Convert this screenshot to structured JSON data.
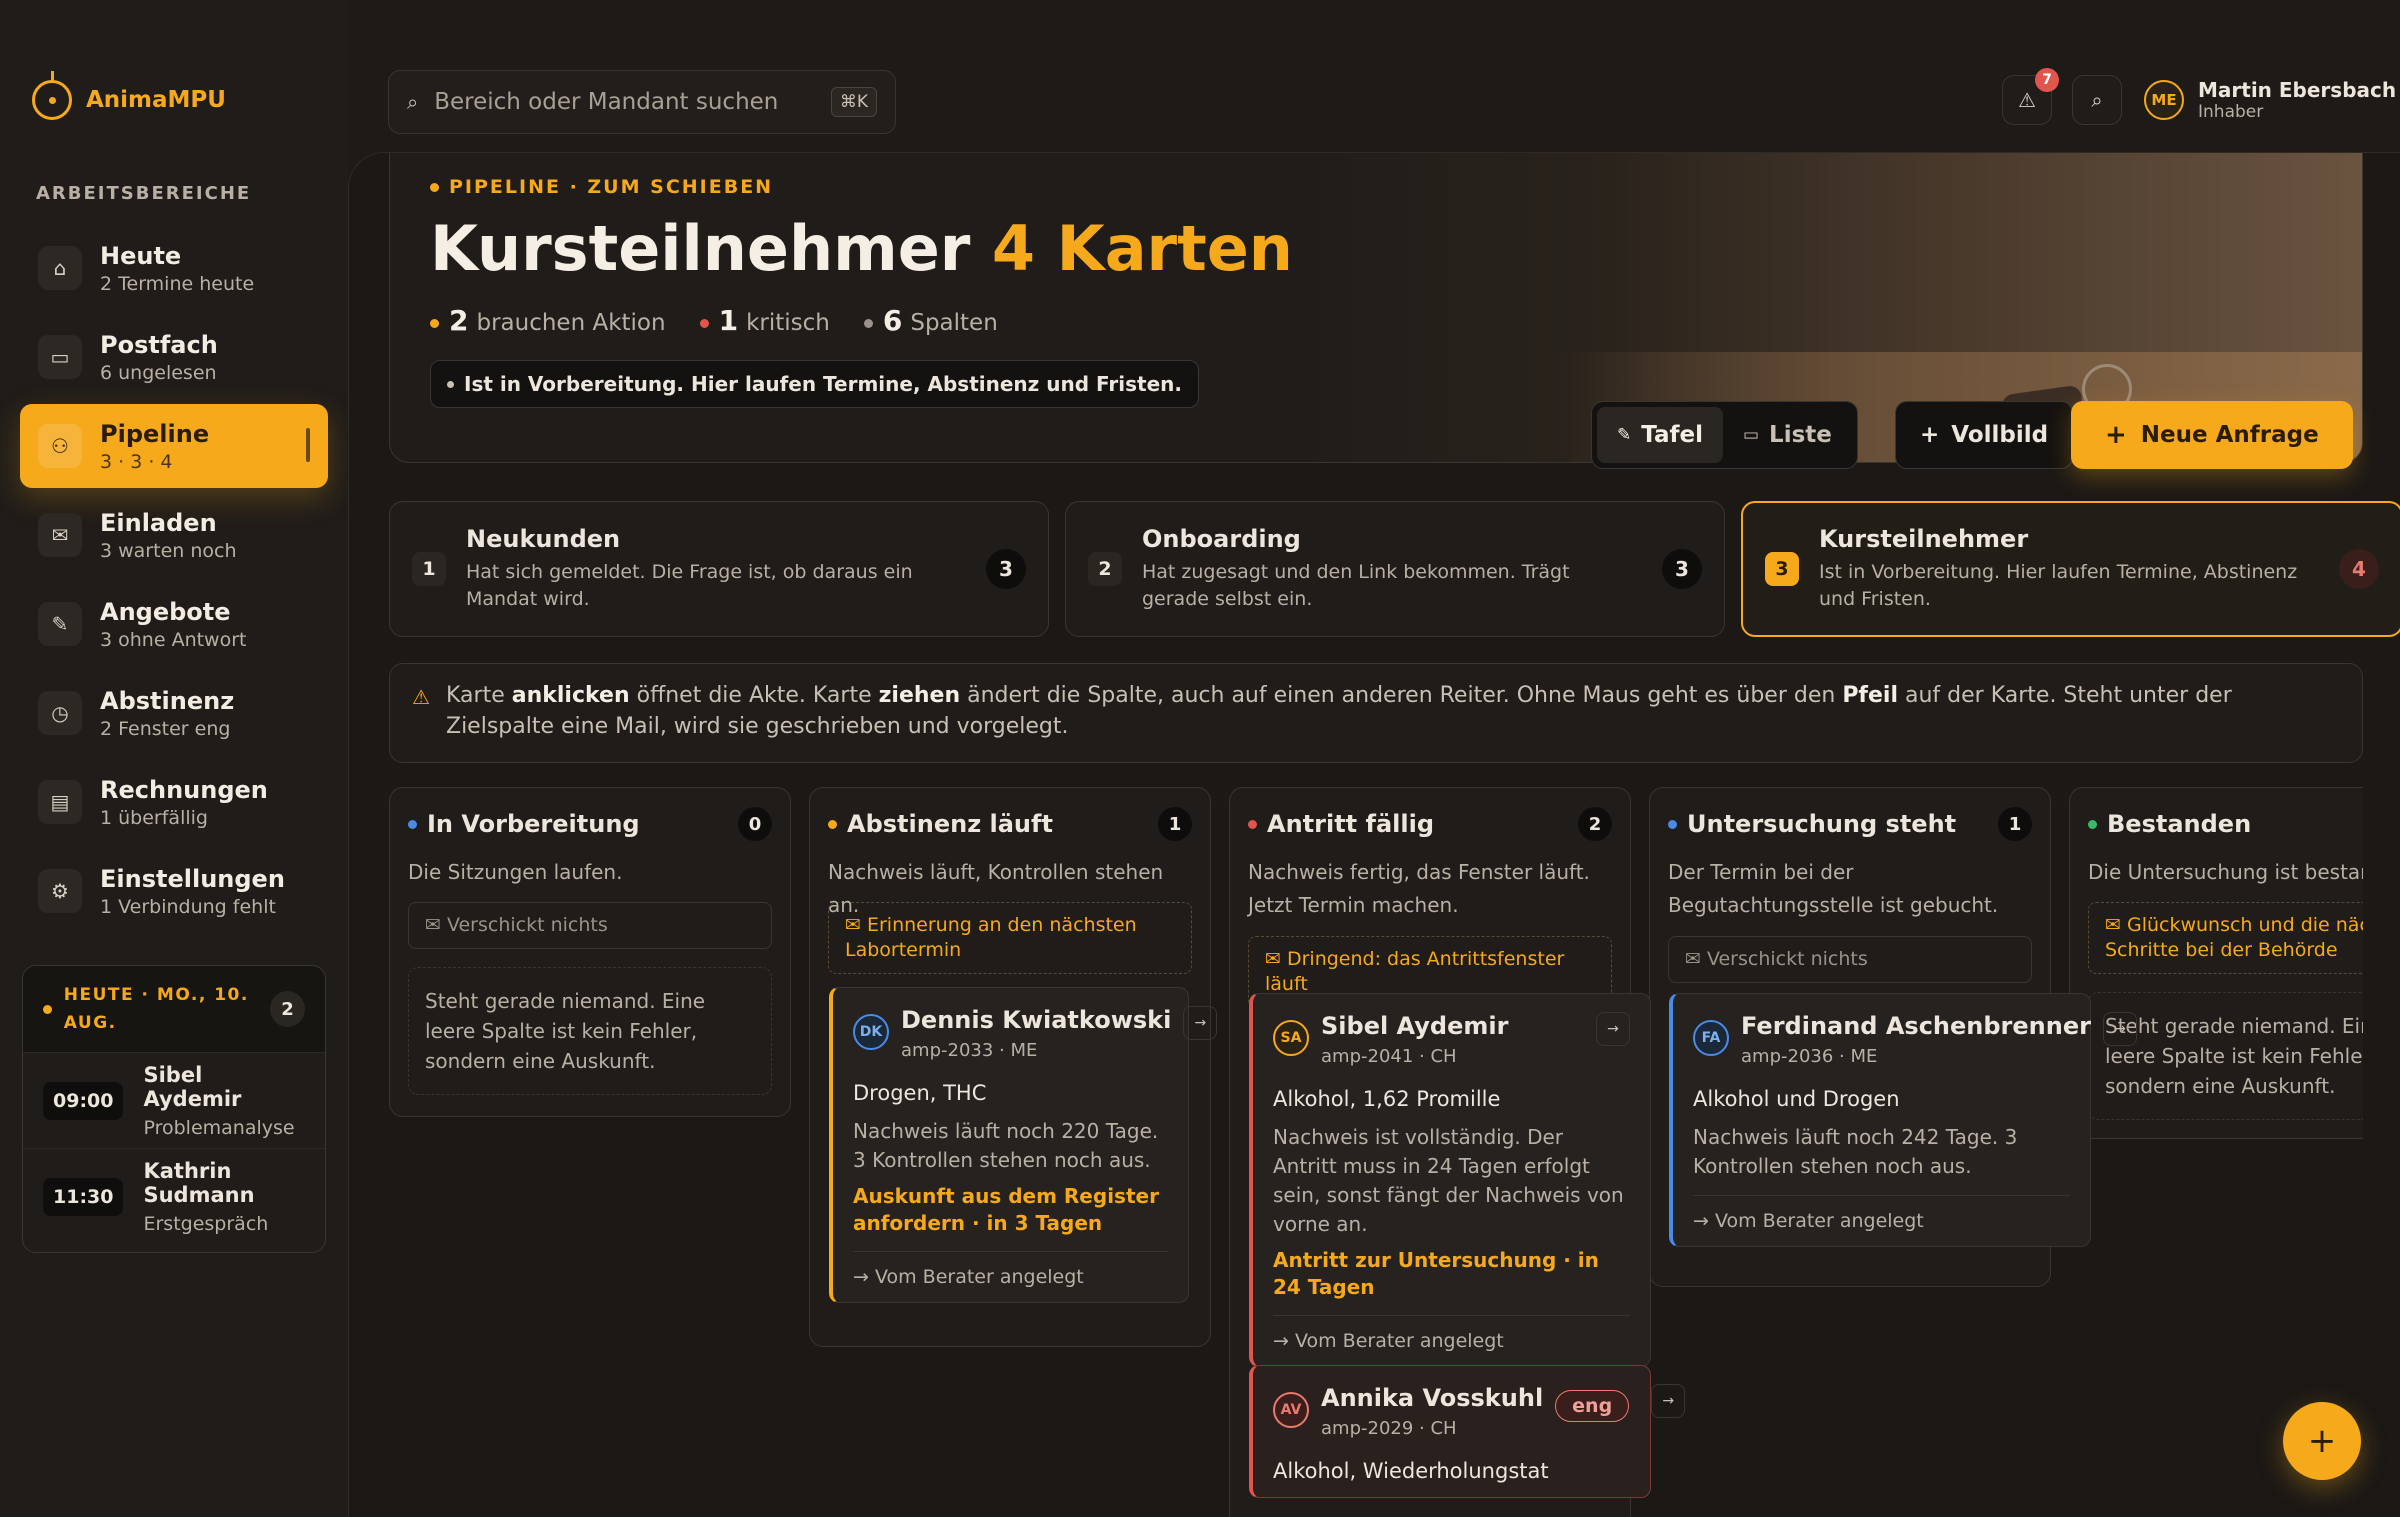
{
  "brand": {
    "name": "AnimaMPU"
  },
  "sidebar": {
    "section_label": "ARBEITSBEREICHE",
    "items": [
      {
        "label": "Heute",
        "sub": "2 Termine heute",
        "icon": "home-icon",
        "glyph": "⌂"
      },
      {
        "label": "Postfach",
        "sub": "6 ungelesen",
        "icon": "inbox-icon",
        "glyph": "▭"
      },
      {
        "label": "Pipeline",
        "sub": "3 · 3 · 4",
        "icon": "users-icon",
        "glyph": "⚇"
      },
      {
        "label": "Einladen",
        "sub": "3 warten noch",
        "icon": "mail-icon",
        "glyph": "✉"
      },
      {
        "label": "Angebote",
        "sub": "3 ohne Antwort",
        "icon": "tag-icon",
        "glyph": "✎"
      },
      {
        "label": "Abstinenz",
        "sub": "2 Fenster eng",
        "icon": "clock-icon",
        "glyph": "◷"
      },
      {
        "label": "Rechnungen",
        "sub": "1 überfällig",
        "icon": "invoice-icon",
        "glyph": "▤"
      },
      {
        "label": "Einstellungen",
        "sub": "1 Verbindung fehlt",
        "icon": "gear-icon",
        "glyph": "⚙"
      }
    ],
    "active_index": 2
  },
  "today": {
    "title": "HEUTE · MO., 10. AUG.",
    "count": "2",
    "appointments": [
      {
        "time": "09:00",
        "name": "Sibel Aydemir",
        "kind": "Problemanalyse"
      },
      {
        "time": "11:30",
        "name": "Kathrin Sudmann",
        "kind": "Erstgespräch"
      }
    ]
  },
  "search": {
    "placeholder": "Bereich oder Mandant suchen",
    "shortcut": "⌘K"
  },
  "header": {
    "alert_badge": "7",
    "user": {
      "initials": "ME",
      "name": "Martin Ebersbach",
      "role": "Inhaber"
    }
  },
  "hero": {
    "eyebrow": "PIPELINE · ZUM SCHIEBEN",
    "title": "Kursteilnehmer",
    "title_accent": "4 Karten",
    "stats": [
      {
        "value": "2",
        "label": "brauchen Aktion",
        "color": "#f6a91a"
      },
      {
        "value": "1",
        "label": "kritisch",
        "color": "#e0554d"
      },
      {
        "value": "6",
        "label": "Spalten",
        "color": "#9a9288"
      }
    ],
    "pill": "Ist in Vorbereitung. Hier laufen Termine, Abstinenz und Fristen.",
    "view_board": "Tafel",
    "view_list": "Liste",
    "fullscreen": "Vollbild",
    "new_request": "Neue Anfrage"
  },
  "tabs": [
    {
      "num": "1",
      "title": "Neukunden",
      "desc": "Hat sich gemeldet. Die Frage ist, ob daraus ein Mandat wird.",
      "count": "3"
    },
    {
      "num": "2",
      "title": "Onboarding",
      "desc": "Hat zugesagt und den Link bekommen. Trägt gerade selbst ein.",
      "count": "3"
    },
    {
      "num": "3",
      "title": "Kursteilnehmer",
      "desc": "Ist in Vorbereitung. Hier laufen Termine, Abstinenz und Fristen.",
      "count": "4"
    }
  ],
  "hint": {
    "p1": "Karte ",
    "b1": "anklicken",
    "p2": " öffnet die Akte. Karte ",
    "b2": "ziehen",
    "p3": " ändert die Spalte, auch auf einen anderen Reiter. Ohne Maus geht es über den ",
    "b3": "Pfeil",
    "p4": " auf der Karte. Steht unter der Zielspalte eine Mail, wird sie geschrieben und vorgelegt."
  },
  "columns": [
    {
      "title": "In Vorbereitung",
      "count": "0",
      "color": "#4a8ae8",
      "desc": "Die Sitzungen laufen.",
      "mail": "Verschickt nichts",
      "empty": "Steht gerade niemand. Eine leere Spalte ist kein Fehler, sondern eine Auskunft."
    },
    {
      "title": "Abstinenz läuft",
      "count": "1",
      "color": "#f6a91a",
      "desc": "Nachweis läuft, Kontrollen stehen an.",
      "mail": "Erinnerung an den nächsten Labortermin"
    },
    {
      "title": "Antritt fällig",
      "count": "2",
      "color": "#e0554d",
      "desc": "Nachweis fertig, das Fenster läuft. Jetzt Termin machen.",
      "mail": "Dringend: das Antrittsfenster läuft"
    },
    {
      "title": "Untersuchung steht",
      "count": "1",
      "color": "#4a8ae8",
      "desc": "Der Termin bei der Begutachtungsstelle ist gebucht.",
      "mail": "Verschickt nichts"
    },
    {
      "title": "Bestanden",
      "count": "",
      "color": "#3ab86a",
      "desc": "Die Untersuchung ist bestanden.",
      "mail": "Glückwunsch und die nächsten Schritte bei der Behörde",
      "empty": "Steht gerade niemand. Eine leere Spalte ist kein Fehler, sondern eine Auskunft."
    }
  ],
  "cards": [
    {
      "initials": "DK",
      "name": "Dennis Kwiatkowski",
      "id": "amp-2033 · ME",
      "subject": "Drogen, THC",
      "text": "Nachweis läuft noch 220 Tage. 3 Kontrollen stehen noch aus.",
      "action": "Auskunft aus dem Register anfordern · in 3 Tagen",
      "footer": "Vom Berater angelegt",
      "accent": "#f6a91a"
    },
    {
      "initials": "SA",
      "name": "Sibel Aydemir",
      "id": "amp-2041 · CH",
      "subject": "Alkohol, 1,62 Promille",
      "text": "Nachweis ist vollständig. Der Antritt muss in 24 Tagen erfolgt sein, sonst fängt der Nachweis von vorne an.",
      "action": "Antritt zur Untersuchung · in 24 Tagen",
      "footer": "Vom Berater angelegt",
      "accent": "#e0554d"
    },
    {
      "initials": "AV",
      "name": "Annika Vosskuhl",
      "id": "amp-2029 · CH",
      "tag": "eng",
      "subject": "Alkohol, Wiederholungstat",
      "accent": "#e0554d"
    },
    {
      "initials": "FA",
      "name": "Ferdinand Aschenbrenner",
      "id": "amp-2036 · ME",
      "subject": "Alkohol und Drogen",
      "text": "Nachweis läuft noch 242 Tage. 3 Kontrollen stehen noch aus.",
      "footer": "Vom Berater angelegt",
      "accent": "#4a8ae8"
    }
  ]
}
